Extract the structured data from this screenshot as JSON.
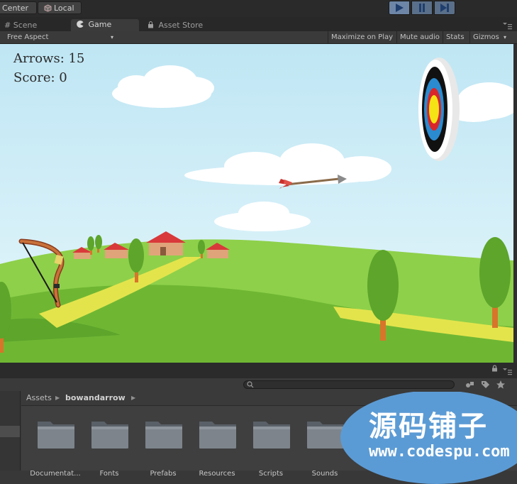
{
  "toolbar": {
    "pivot_label": "Center",
    "space_label": "Local"
  },
  "tabs": {
    "scene": "Scene",
    "game": "Game",
    "asset_store": "Asset Store"
  },
  "game_bar": {
    "aspect": "Free Aspect",
    "maximize": "Maximize on Play",
    "mute": "Mute audio",
    "stats": "Stats",
    "gizmos": "Gizmos"
  },
  "game_hud": {
    "arrows": "Arrows: 15",
    "score": "Score: 0"
  },
  "project": {
    "breadcrumb": [
      "Assets",
      "bowandarrow"
    ],
    "folders": [
      "Documentat...",
      "Fonts",
      "Prefabs",
      "Resources",
      "Scripts",
      "Sounds"
    ]
  },
  "watermark": {
    "title": "源码铺子",
    "url": "www.codespu.com"
  },
  "colors": {
    "sky": "#cfeef8",
    "grass": "#7cc23a",
    "path": "#e1e24a",
    "play_active": "#6d86a7",
    "watermark": "#5b9bd5"
  },
  "icons": {
    "play": "play-icon",
    "pause": "pause-icon",
    "step": "step-icon",
    "folder": "folder-icon"
  }
}
